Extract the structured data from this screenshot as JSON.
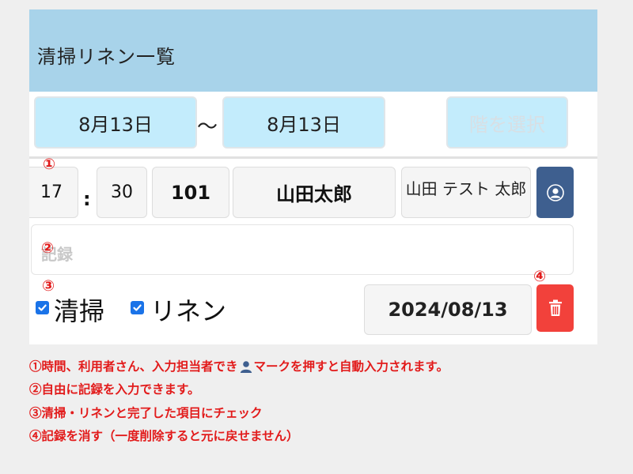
{
  "header": {
    "title": "清掃リネン一覧"
  },
  "date_range": {
    "start": "8月13日",
    "separator": "～",
    "end": "8月13日"
  },
  "floor_button": {
    "label": "階を選択"
  },
  "record": {
    "hour": "17",
    "time_separator": ":",
    "minute": "30",
    "room": "101",
    "user_name": "山田太郎",
    "staff_name": "山田 テスト 太郎"
  },
  "notes": {
    "placeholder": "記録"
  },
  "checks": {
    "cleaning": {
      "label": "清掃",
      "checked": true
    },
    "linen": {
      "label": "リネン",
      "checked": true
    }
  },
  "completion_date": "2024/08/13",
  "markers": {
    "m1": "①",
    "m2": "②",
    "m3": "③",
    "m4": "④"
  },
  "instructions": {
    "line1_before": "①時間、利用者さん、入力担当者でき",
    "line1_after": "マークを押すと自動入力されます。",
    "line2": "②自由に記録を入力できます。",
    "line3": "③清掃・リネンと完了した項目にチェック",
    "line4": "④記録を消す（一度削除すると元に戻せません）"
  },
  "icons": {
    "user_button": "user-circle-icon",
    "delete_button": "trash-icon",
    "inline_user": "user-icon"
  },
  "colors": {
    "header_bg": "#a8d3ea",
    "date_button_bg": "#c3ecfc",
    "user_button_bg": "#3e5f8f",
    "delete_button_bg": "#f2413b",
    "checkbox": "#1a73e8",
    "annotation": "#e21b1b"
  }
}
